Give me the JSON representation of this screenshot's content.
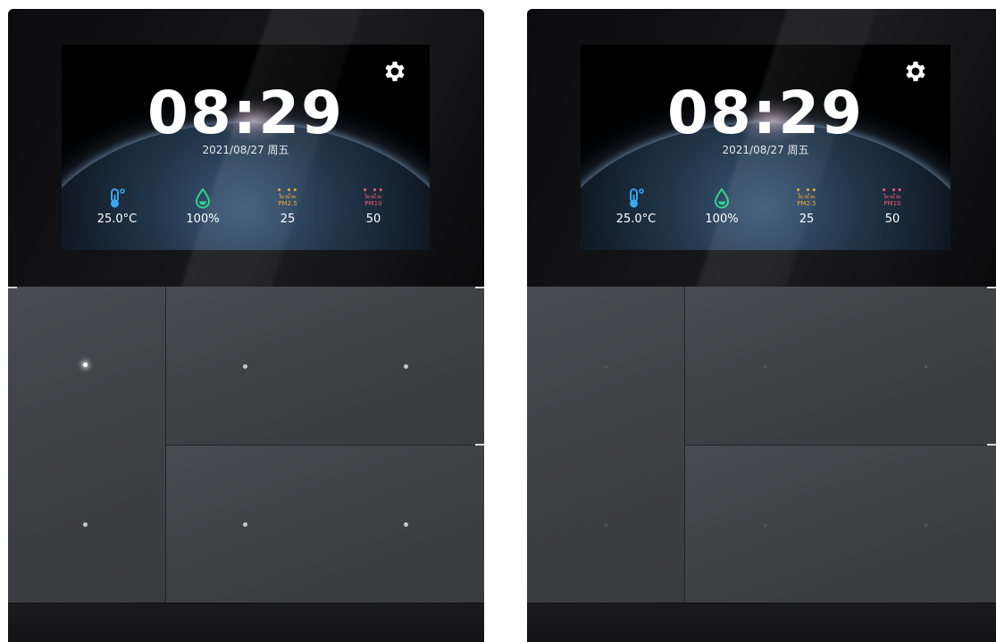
{
  "devices": [
    {
      "time": "08:29",
      "date": "2021/08/27 周五",
      "sensors": {
        "temperature": "25.0°C",
        "humidity": "100%",
        "pm25": "25",
        "pm25_label": "PM2.5",
        "pm10": "50",
        "pm10_label": "PM10"
      }
    },
    {
      "time": "08:29",
      "date": "2021/08/27 周五",
      "sensors": {
        "temperature": "25.0°C",
        "humidity": "100%",
        "pm25": "25",
        "pm25_label": "PM2.5",
        "pm10": "50",
        "pm10_label": "PM10"
      }
    }
  ],
  "icons": {
    "settings": "gear-icon",
    "temperature": "thermometer-icon",
    "humidity": "water-drop-icon",
    "pm25": "pm25-icon",
    "pm10": "pm10-icon"
  },
  "colors": {
    "temperature": "#3aa7f0",
    "humidity": "#2fd48a",
    "pm25": "#f0a328",
    "pm10": "#f25a6e"
  },
  "indicator_state": {
    "device1_top_left_led": "on"
  }
}
